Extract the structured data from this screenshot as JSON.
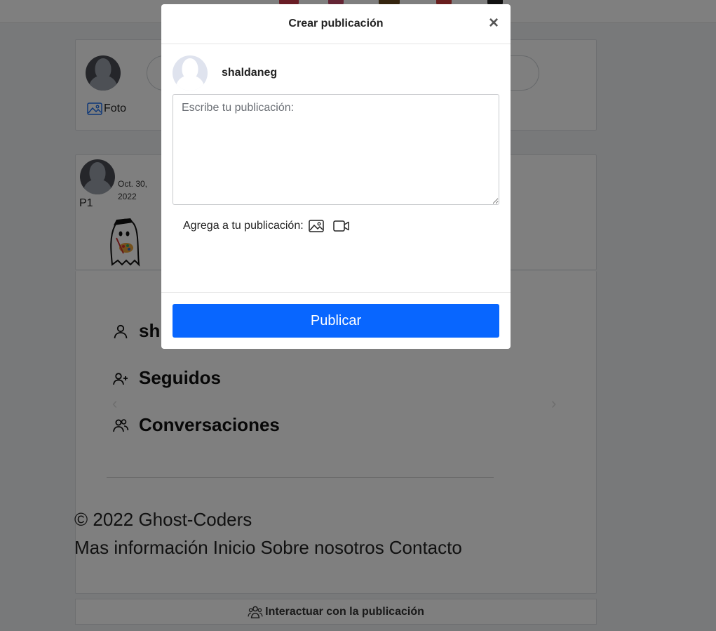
{
  "modal": {
    "title": "Crear publicación",
    "close_label": "×",
    "username": "shaldaneg",
    "textarea_placeholder": "Escribe tu publicación:",
    "add_label": "Agrega a tu publicación:",
    "add_icons": [
      "image-icon",
      "video-camera-icon"
    ],
    "publish_label": "Publicar",
    "accent_color": "#0866ff"
  },
  "create_post": {
    "photo_label": "Foto"
  },
  "post": {
    "date": "Oct. 30, 2022",
    "title": "P1"
  },
  "menu": {
    "items": [
      {
        "label": "sh",
        "icon": "person-icon"
      },
      {
        "label": "Seguidos",
        "icon": "person-plus-icon"
      },
      {
        "label": "Conversaciones",
        "icon": "people-icon"
      }
    ]
  },
  "footer": {
    "copyright": "© 2022 Ghost-Coders",
    "links": [
      "Mas información",
      "Inicio",
      "Sobre nosotros",
      "Contacto"
    ]
  },
  "interact_label": "Interactuar con la publicación"
}
